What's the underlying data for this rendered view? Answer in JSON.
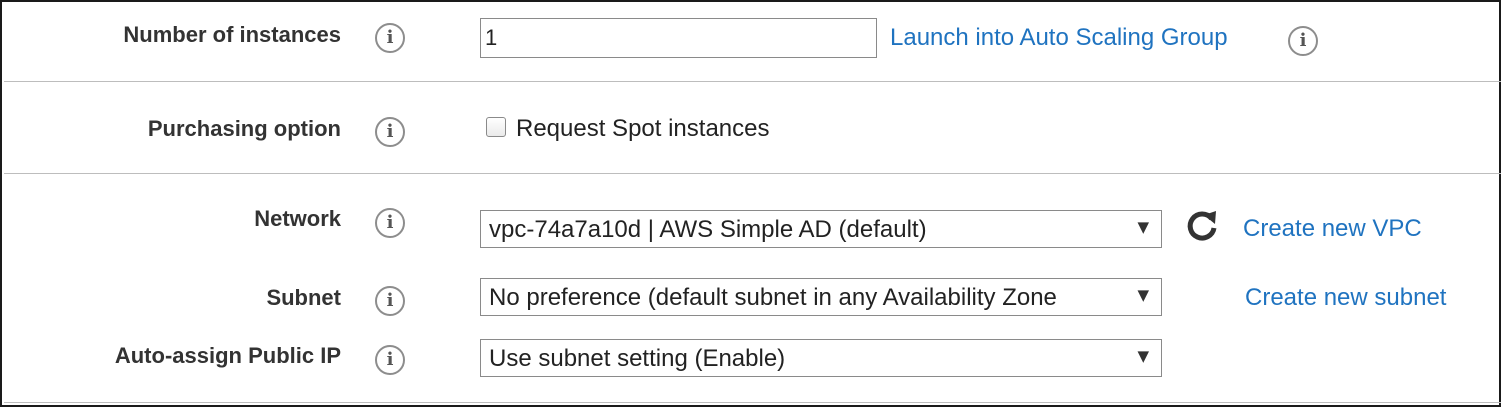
{
  "instances": {
    "label": "Number of instances",
    "info_icon": "info-icon",
    "value": "1",
    "asg_link": "Launch into Auto Scaling Group"
  },
  "purchasing": {
    "label": "Purchasing option",
    "spot_checkbox_label": "Request Spot instances",
    "spot_checked": false
  },
  "network": {
    "label": "Network",
    "selected": "vpc-74a7a10d | AWS Simple AD (default)",
    "refresh_icon": "refresh-icon",
    "create_link": "Create new VPC"
  },
  "subnet": {
    "label": "Subnet",
    "selected": "No preference (default subnet in any Availability Zone",
    "create_link": "Create new subnet"
  },
  "public_ip": {
    "label": "Auto-assign Public IP",
    "selected": "Use subnet setting (Enable)"
  },
  "dropdown_arrow": "▼",
  "colors": {
    "link": "#1f73c0",
    "label": "#333333",
    "border": "#8a8a8a"
  }
}
